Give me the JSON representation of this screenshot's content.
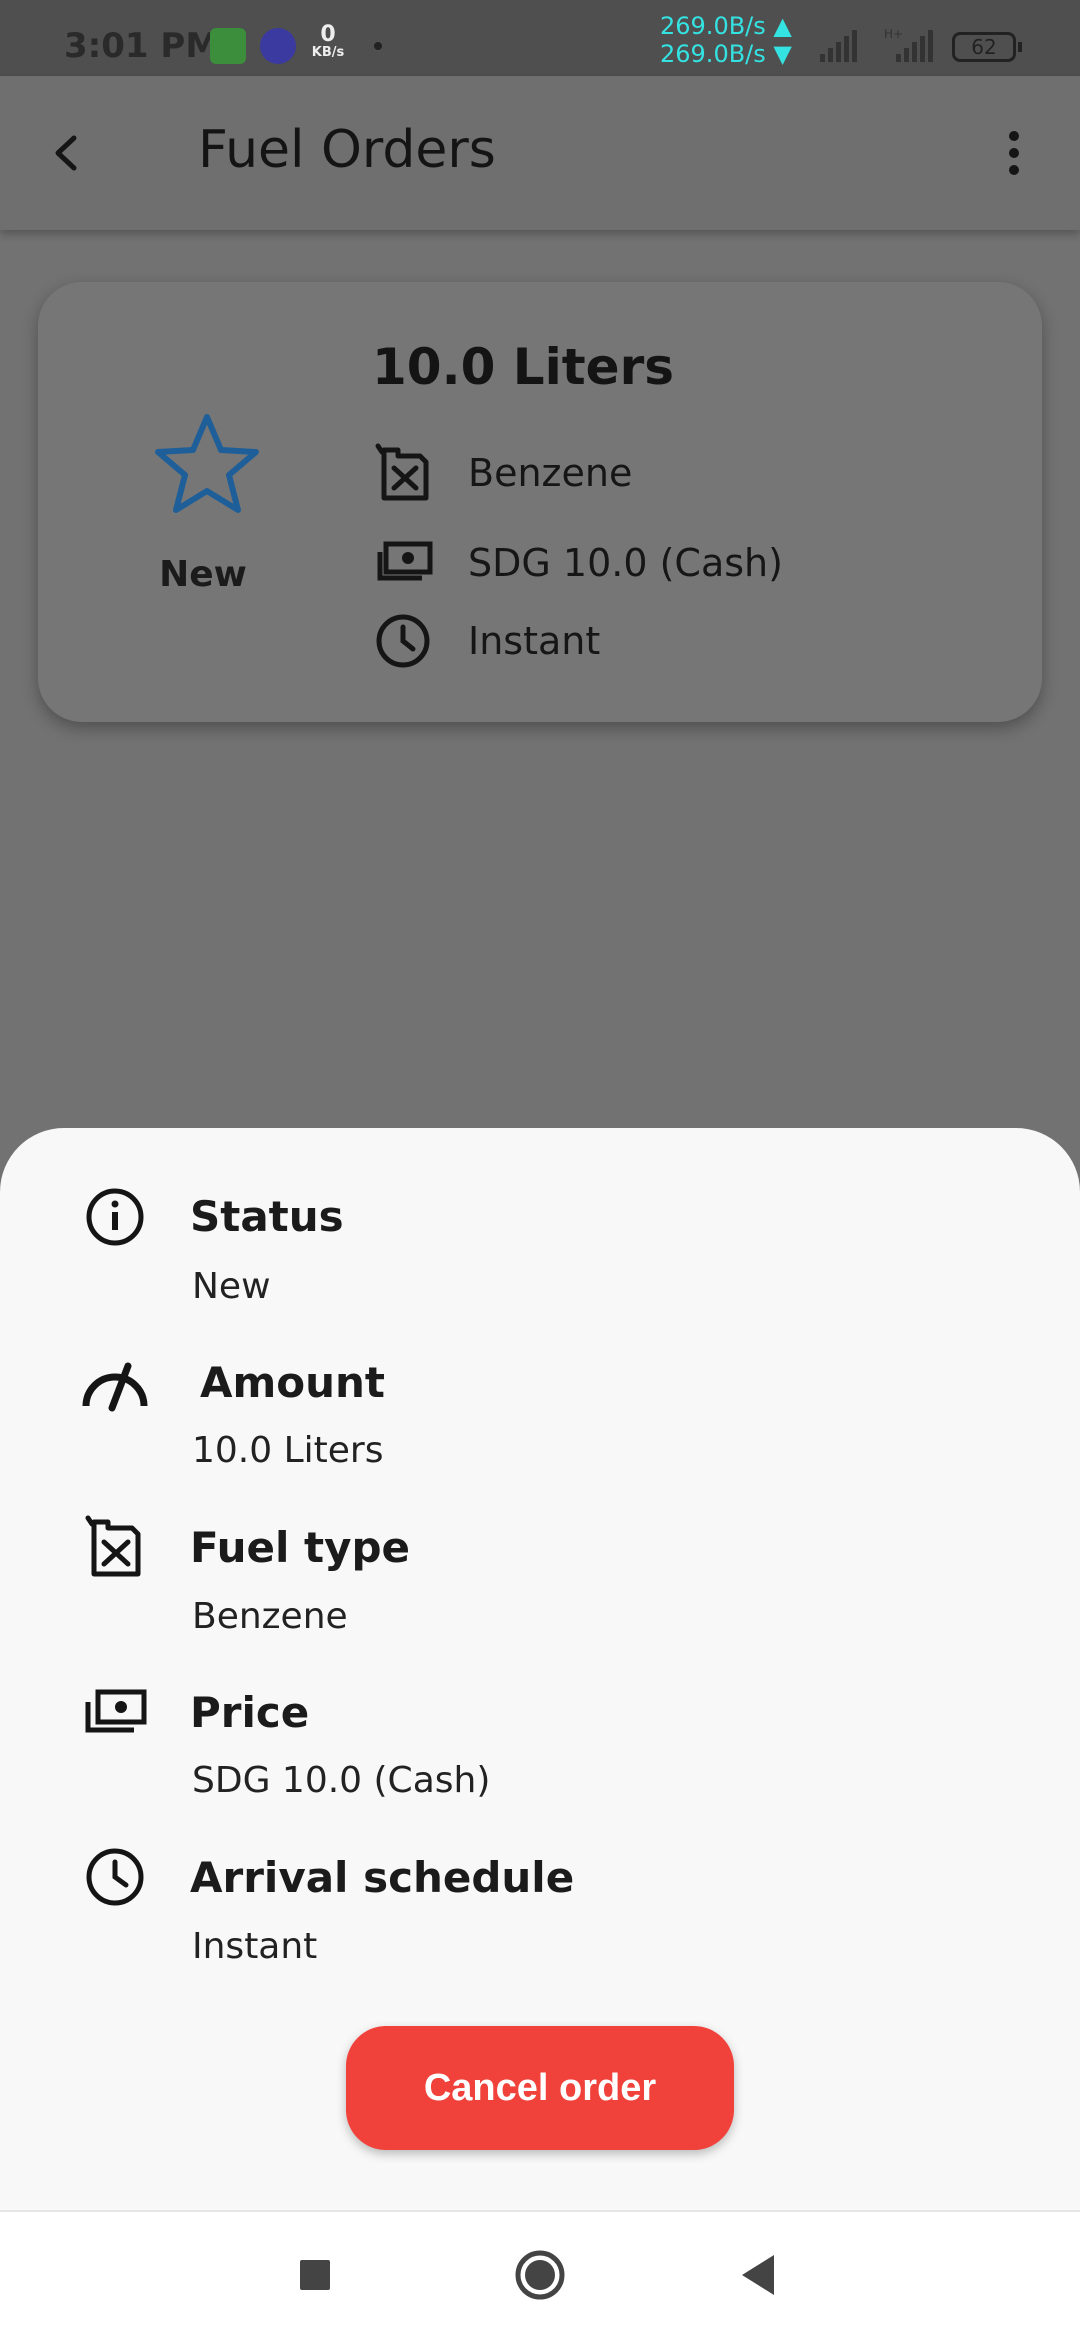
{
  "status_bar": {
    "time": "3:01 PM",
    "speed_value": "0",
    "speed_unit": "KB/s",
    "upload": "269.0B/s ▲",
    "download": "269.0B/s ▼",
    "network_type": "H+",
    "battery": "62"
  },
  "app_bar": {
    "title": "Fuel Orders"
  },
  "order_card": {
    "status": "New",
    "amount": "10.0 Liters",
    "fuel_type": "Benzene",
    "price": "SDG 10.0 (Cash)",
    "schedule": "Instant"
  },
  "details": {
    "status_label": "Status",
    "status_value": "New",
    "amount_label": "Amount",
    "amount_value": "10.0 Liters",
    "fuel_label": "Fuel type",
    "fuel_value": "Benzene",
    "price_label": "Price",
    "price_value": "SDG 10.0 (Cash)",
    "schedule_label": "Arrival schedule",
    "schedule_value": "Instant"
  },
  "actions": {
    "cancel_label": "Cancel order"
  },
  "colors": {
    "accent_red": "#f0413a",
    "star_blue": "#1f5f99",
    "net_speed": "#35e2e2"
  }
}
